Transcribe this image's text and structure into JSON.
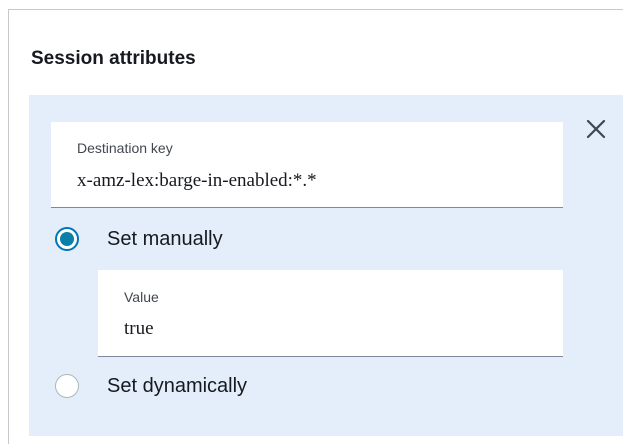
{
  "session_attributes": {
    "title": "Session attributes",
    "close_icon": "close-icon",
    "destination_key": {
      "label": "Destination key",
      "value": "x-amz-lex:barge-in-enabled:*.*"
    },
    "options": [
      {
        "label": "Set manually",
        "selected": true
      },
      {
        "label": "Set dynamically",
        "selected": false
      }
    ],
    "value_field": {
      "label": "Value",
      "value": "true"
    }
  },
  "colors": {
    "panel_background": "#e3eefa",
    "radio_selected": "#0a7fa8",
    "text": "#16191f"
  }
}
